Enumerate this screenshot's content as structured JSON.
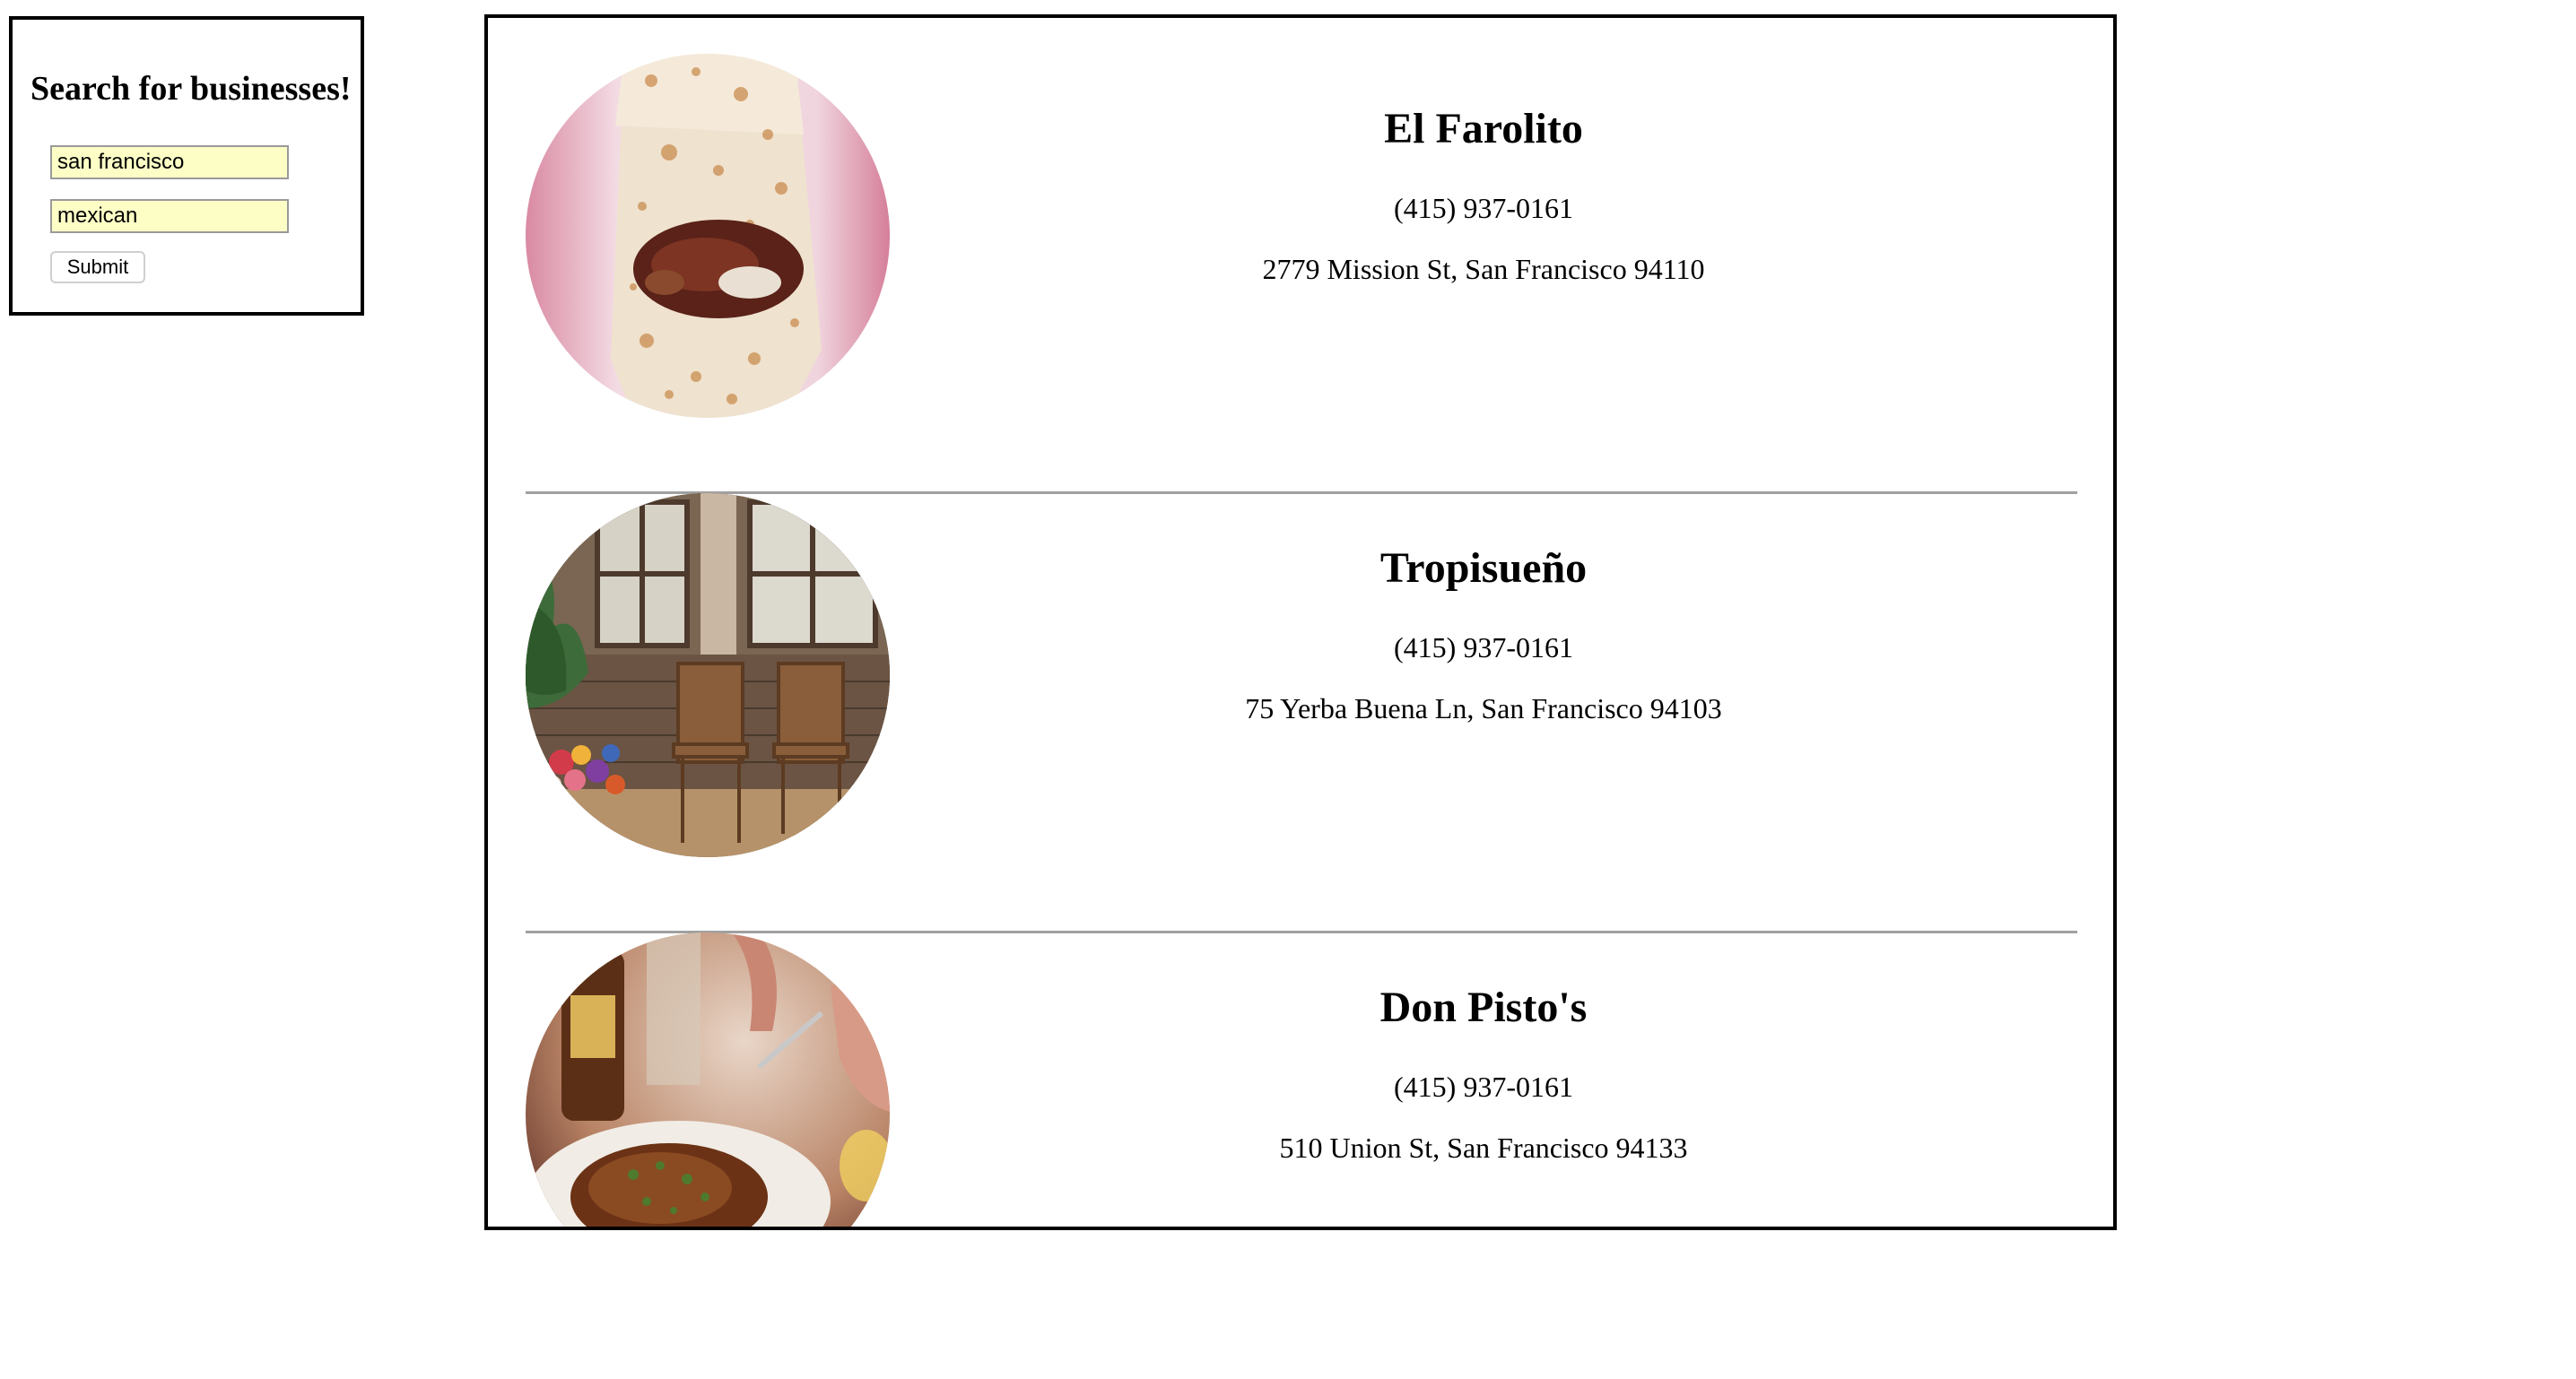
{
  "search": {
    "title": "Search for businesses!",
    "location_value": "san francisco",
    "term_value": "mexican",
    "submit_label": "Submit"
  },
  "results": [
    {
      "name": "El Farolito",
      "phone": "(415) 937-0161",
      "address": "2779 Mission St, San Francisco 94110",
      "image_icon": "burrito-photo"
    },
    {
      "name": "Tropisueño",
      "phone": "(415) 937-0161",
      "address": "75 Yerba Buena Ln, San Francisco 94103",
      "image_icon": "restaurant-interior-photo"
    },
    {
      "name": "Don Pisto's",
      "phone": "(415) 937-0161",
      "address": "510 Union St, San Francisco 94133",
      "image_icon": "steak-dish-photo"
    }
  ],
  "colors": {
    "input_background": "#fdfdc6",
    "border": "#000000",
    "divider": "#a0a0a0"
  }
}
